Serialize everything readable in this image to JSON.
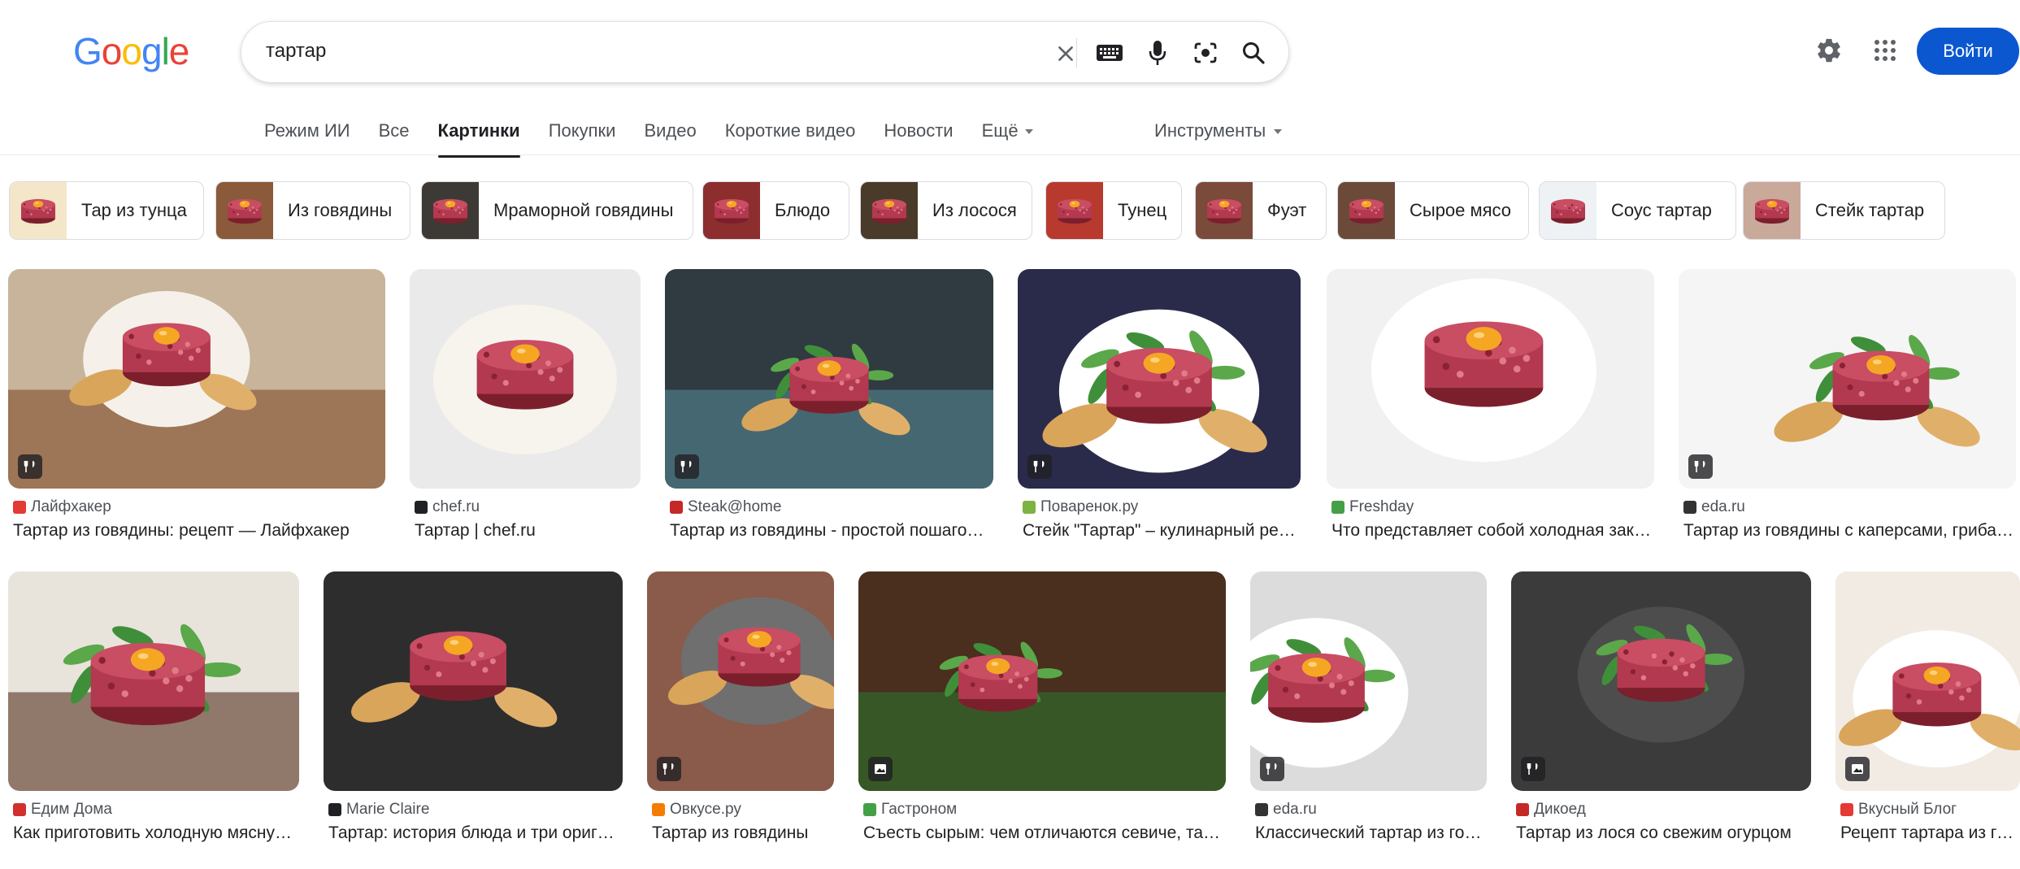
{
  "logo": {
    "text": "Google"
  },
  "search": {
    "query": "тартар"
  },
  "header": {
    "signin_label": "Войти"
  },
  "tabs": [
    {
      "label": "Режим ИИ"
    },
    {
      "label": "Все"
    },
    {
      "label": "Картинки",
      "active": true
    },
    {
      "label": "Покупки"
    },
    {
      "label": "Видео"
    },
    {
      "label": "Короткие видео"
    },
    {
      "label": "Новости"
    },
    {
      "label": "Ещё"
    }
  ],
  "tools_label": "Инструменты",
  "chips": [
    {
      "label": "Тар из тунца"
    },
    {
      "label": "Из говядины"
    },
    {
      "label": "Мраморной говядины"
    },
    {
      "label": "Блюдо"
    },
    {
      "label": "Из лосося"
    },
    {
      "label": "Тунец"
    },
    {
      "label": "Фуэт"
    },
    {
      "label": "Сырое мясо"
    },
    {
      "label": "Соус тартар"
    },
    {
      "label": "Стейк тартар"
    }
  ],
  "results": [
    {
      "source": "Лайфхакер",
      "title": "Тартар из говядины: рецепт — Лайфхакер",
      "badge": "recipe",
      "favicon_color": "#e53935"
    },
    {
      "source": "chef.ru",
      "title": "Тартар | chef.ru",
      "badge": "",
      "favicon_color": "#202124"
    },
    {
      "source": "Steak@home",
      "title": "Тартар из говядины - простой пошаговый рецепт",
      "badge": "recipe",
      "favicon_color": "#c62828"
    },
    {
      "source": "Поваренок.ру",
      "title": "Стейк \"Тартар\" – кулинарный рецепт",
      "badge": "recipe",
      "favicon_color": "#7cb342"
    },
    {
      "source": "Freshday",
      "title": "Что представляет собой холодная закуска тартар",
      "badge": "",
      "favicon_color": "#43a047"
    },
    {
      "source": "eda.ru",
      "title": "Тартар из говядины с каперсами, грибами",
      "badge": "recipe",
      "favicon_color": "#333333"
    },
    {
      "source": "Едим Дома",
      "title": "Как приготовить холодную мясную закуску",
      "badge": "",
      "favicon_color": "#d32f2f"
    },
    {
      "source": "Marie Claire",
      "title": "Тартар: история блюда и три оригинальных рецепта",
      "badge": "",
      "favicon_color": "#202124"
    },
    {
      "source": "Овкусе.ру",
      "title": "Тартар из говядины",
      "badge": "recipe",
      "favicon_color": "#f57c00"
    },
    {
      "source": "Гастроном",
      "title": "Съесть сырым: чем отличаются севиче, тартар и карпаччо",
      "badge": "image",
      "favicon_color": "#43a047"
    },
    {
      "source": "eda.ru",
      "title": "Классический тартар из говядины",
      "badge": "recipe",
      "favicon_color": "#333333"
    },
    {
      "source": "Дикоед",
      "title": "Тартар из лося со свежим огурцом",
      "badge": "recipe",
      "favicon_color": "#c62828"
    },
    {
      "source": "Вкусный Блог",
      "title": "Рецепт тартара из говядины",
      "badge": "image",
      "favicon_color": "#e53935"
    }
  ],
  "colors": {
    "accent": "#0b57d0",
    "google_blue": "#4285f4",
    "google_red": "#ea4335",
    "google_yellow": "#fbbc05",
    "google_green": "#34a853"
  }
}
